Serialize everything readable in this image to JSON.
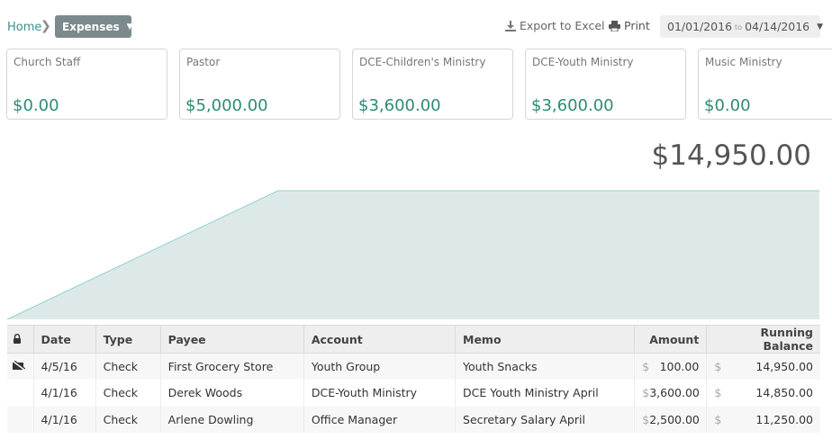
{
  "breadcrumb": {
    "home": "Home",
    "current": "Expenses"
  },
  "toolbar": {
    "export_label": "Export to Excel",
    "print_label": "Print"
  },
  "date_range": {
    "start": "01/01/2016",
    "separator": "to",
    "end": "04/14/2016"
  },
  "cards": [
    {
      "name": "Church Staff",
      "amount": "$0.00"
    },
    {
      "name": "Pastor",
      "amount": "$5,000.00"
    },
    {
      "name": "DCE-Children's Ministry",
      "amount": "$3,600.00"
    },
    {
      "name": "DCE-Youth Ministry",
      "amount": "$3,600.00"
    },
    {
      "name": "Music Ministry",
      "amount": "$0.00"
    }
  ],
  "total": "$14,950.00",
  "chart_data": {
    "type": "area",
    "x": [
      0,
      1,
      2,
      3
    ],
    "values": [
      0,
      14950,
      14950,
      14950
    ],
    "fill_color": "#dde9e9",
    "line_color": "#8fd3d0"
  },
  "table": {
    "headers": {
      "lock": "",
      "date": "Date",
      "type": "Type",
      "payee": "Payee",
      "account": "Account",
      "memo": "Memo",
      "amount": "Amount",
      "balance": "Running Balance"
    },
    "currency": "$",
    "rows": [
      {
        "icon": "reconciled-check-icon",
        "date": "4/5/16",
        "type": "Check",
        "payee": "First Grocery Store",
        "account": "Youth Group",
        "memo": "Youth Snacks",
        "amount": "100.00",
        "balance": "14,950.00"
      },
      {
        "icon": "",
        "date": "4/1/16",
        "type": "Check",
        "payee": "Derek Woods",
        "account": "DCE-Youth Ministry",
        "memo": "DCE Youth Ministry April",
        "amount": "3,600.00",
        "balance": "14,850.00"
      },
      {
        "icon": "",
        "date": "4/1/16",
        "type": "Check",
        "payee": "Arlene Dowling",
        "account": "Office Manager",
        "memo": "Secretary Salary April",
        "amount": "2,500.00",
        "balance": "11,250.00"
      }
    ]
  }
}
